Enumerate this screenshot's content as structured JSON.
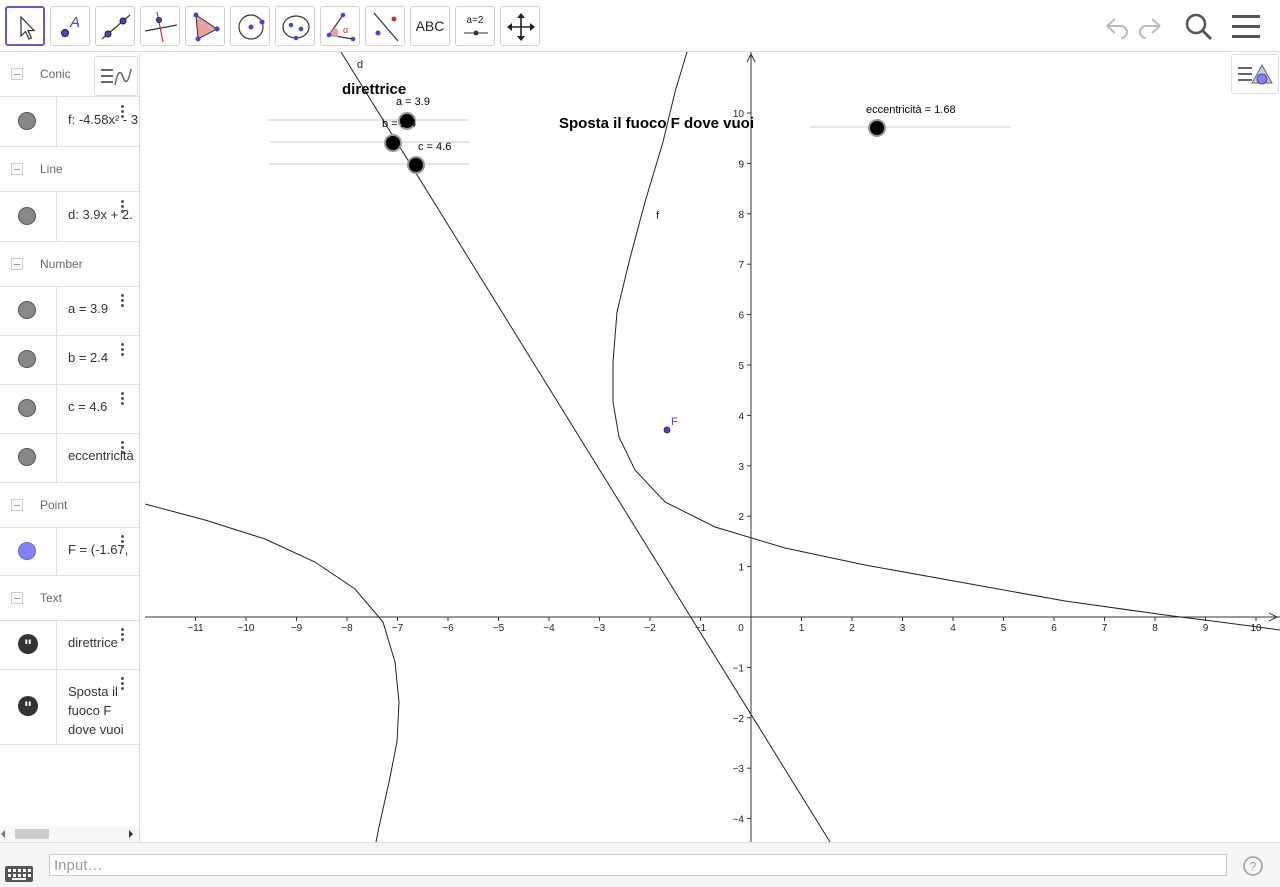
{
  "toolbar": {
    "text_tool_label": "ABC",
    "slider_tool_label": "a=2",
    "tools": [
      "move-tool",
      "point-tool",
      "line-tool",
      "perpendicular-tool",
      "polygon-tool",
      "circle-tool",
      "conic-tool",
      "angle-tool",
      "reflect-tool",
      "text-tool",
      "slider-tool",
      "move-view-tool"
    ],
    "right": [
      "undo-icon",
      "redo-icon",
      "search-icon",
      "menu-icon"
    ]
  },
  "algebra": {
    "categories": {
      "conic": "Conic",
      "line": "Line",
      "number": "Number",
      "point": "Point",
      "text": "Text"
    },
    "items": {
      "f": "f: -4.58x² - 3",
      "d": "d: 3.9x + 2.",
      "a": "a = 3.9",
      "b": "b = 2.4",
      "c": "c = 4.6",
      "ecc": "eccentricità",
      "F": "F = (-1.67,",
      "text1": "direttrice",
      "text2_line1": "Sposta il",
      "text2_line2": "fuoco F",
      "text2_line3": "dove vuoi"
    },
    "colors": {
      "marble": "#888888",
      "point_marble": "#8080ff"
    }
  },
  "graphics": {
    "label_direttrice": "direttrice",
    "label_sposta": "Sposta il fuoco F dove vuoi",
    "slider_a": "a = 3.9",
    "slider_b": "b = 2.4",
    "slider_c": "c = 4.6",
    "slider_ecc": "eccentricità = 1.68",
    "label_d": "d",
    "label_f": "f",
    "label_F": "F",
    "x_ticks": [
      "-11",
      "-10",
      "-9",
      "-8",
      "-7",
      "-6",
      "-5",
      "-4",
      "-3",
      "-2",
      "-1",
      "0",
      "1",
      "2",
      "3",
      "4",
      "5",
      "6",
      "7",
      "8",
      "9",
      "10"
    ],
    "y_ticks": [
      "10",
      "9",
      "8",
      "7",
      "6",
      "5",
      "4",
      "3",
      "2",
      "1",
      "-1",
      "-2",
      "-3",
      "-4"
    ],
    "point_color": "#4444dd"
  },
  "input": {
    "placeholder": "Input…"
  }
}
